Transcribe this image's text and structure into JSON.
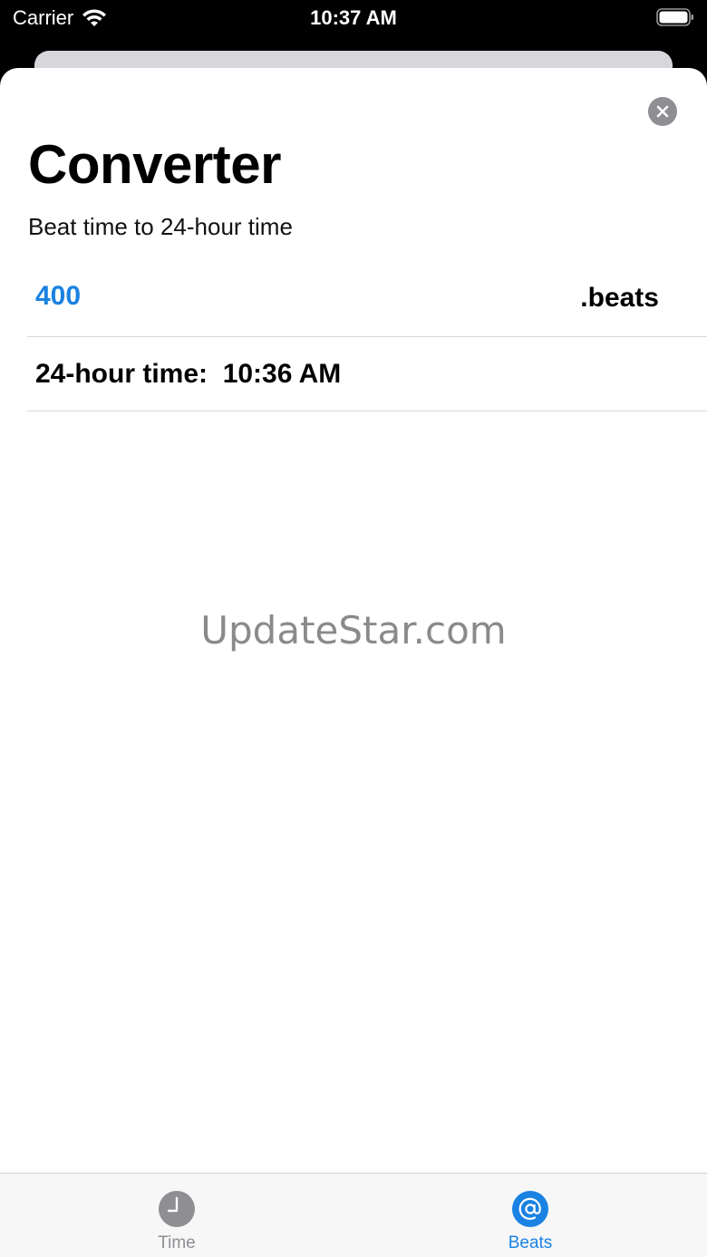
{
  "status_bar": {
    "carrier": "Carrier",
    "time": "10:37 AM"
  },
  "sheet": {
    "title": "Converter",
    "subtitle": "Beat time to 24-hour time",
    "beats_value": "400",
    "beats_unit": ".beats",
    "time_label": "24-hour time:  10:36 AM"
  },
  "watermark": "UpdateStar.com",
  "tabs": [
    {
      "label": "Time",
      "icon": "clock-icon",
      "selected": false
    },
    {
      "label": "Beats",
      "icon": "at-sign-icon",
      "selected": true
    }
  ],
  "colors": {
    "accent": "#1a82e2",
    "inactive": "#8e8e93"
  }
}
